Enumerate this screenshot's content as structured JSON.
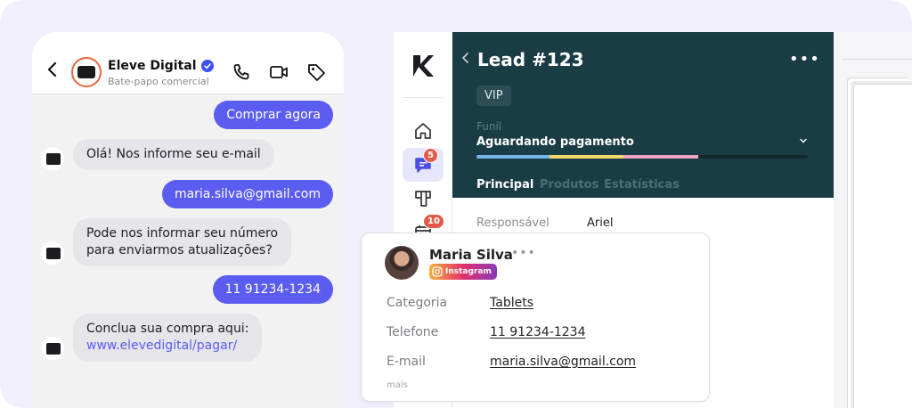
{
  "chat": {
    "brand_name": "Eleve Digital",
    "brand_subtitle": "Bate-papo comercial",
    "icons": [
      "back-arrow-icon",
      "verified-check-icon",
      "phone-icon",
      "video-camera-icon",
      "tag-icon"
    ],
    "messages": [
      {
        "from": "user",
        "text": "Comprar agora"
      },
      {
        "from": "bot",
        "text": "Olá! Nos informe seu e-mail"
      },
      {
        "from": "user",
        "text": "maria.silva@gmail.com"
      },
      {
        "from": "bot",
        "line1": "Pode nos informar seu número",
        "line2": "para enviarmos atualizações?"
      },
      {
        "from": "user",
        "text": "11 91234-1234"
      },
      {
        "from": "bot",
        "line1": "Conclua sua compra aqui:",
        "link": "www.elevedigital/pagar/"
      }
    ]
  },
  "crm": {
    "rail": {
      "icons": [
        "logo-k",
        "home-icon",
        "chat-icon",
        "kanban-icon",
        "calendar-icon"
      ],
      "chat_badge": "5",
      "calendar_badge": "10"
    },
    "lead": {
      "title": "Lead #123",
      "more": "•••",
      "tag": "VIP",
      "funnel_label": "Funil",
      "funnel_value": "Aguardando pagamento",
      "funnel_progress": 0.67,
      "tabs": [
        "Principal",
        "Produtos",
        "Estatísticas"
      ],
      "active_tab": "Principal"
    },
    "fields": [
      {
        "label": "Responsável",
        "value": "Ariel"
      }
    ],
    "colors": {
      "header": "#1a3c44",
      "accent": "#5b5cf0",
      "badge": "#e35a4b"
    }
  },
  "contact_card": {
    "name": "Maria Silva",
    "more": "•••",
    "source_tag": "Instagram",
    "fields": [
      {
        "label": "Categoria",
        "value": "Tablets"
      },
      {
        "label": "Telefone",
        "value": "11 91234-1234"
      },
      {
        "label": "E-mail",
        "value": "maria.silva@gmail.com"
      }
    ],
    "more_link": "mais"
  }
}
